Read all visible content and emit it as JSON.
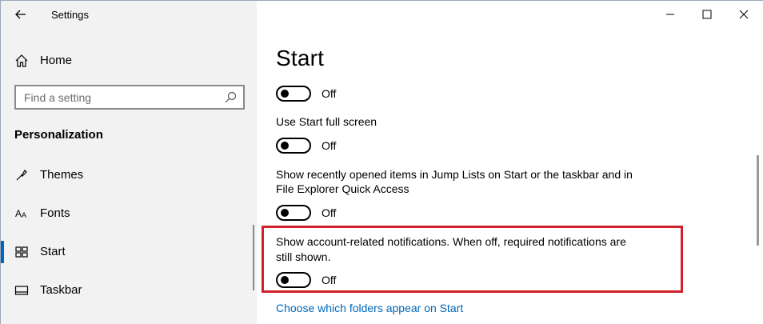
{
  "window": {
    "title": "Settings",
    "controls": [
      "minimize-icon",
      "maximize-icon",
      "close-icon"
    ]
  },
  "sidebar": {
    "home_label": "Home",
    "search": {
      "placeholder": "Find a setting",
      "value": ""
    },
    "section_label": "Personalization",
    "items": [
      {
        "label": "Themes",
        "icon": "themes-icon",
        "selected": false
      },
      {
        "label": "Fonts",
        "icon": "fonts-icon",
        "selected": false
      },
      {
        "label": "Start",
        "icon": "start-icon",
        "selected": true
      },
      {
        "label": "Taskbar",
        "icon": "taskbar-icon",
        "selected": false
      }
    ]
  },
  "main": {
    "title": "Start",
    "settings": [
      {
        "label": "",
        "state": "Off"
      },
      {
        "label": "Use Start full screen",
        "state": "Off"
      },
      {
        "label_line1": "Show recently opened items in Jump Lists on Start or the taskbar and in",
        "label_line2": "File Explorer Quick Access",
        "state": "Off"
      },
      {
        "label_line1": "Show account-related notifications. When off, required notifications are",
        "label_line2": "still shown.",
        "state": "Off",
        "highlighted": true
      }
    ],
    "link": "Choose which folders appear on Start"
  },
  "colors": {
    "accent": "#0067c0",
    "link": "#0067b8",
    "highlight": "#d1202a",
    "sidebar_bg": "#f2f2f2"
  }
}
